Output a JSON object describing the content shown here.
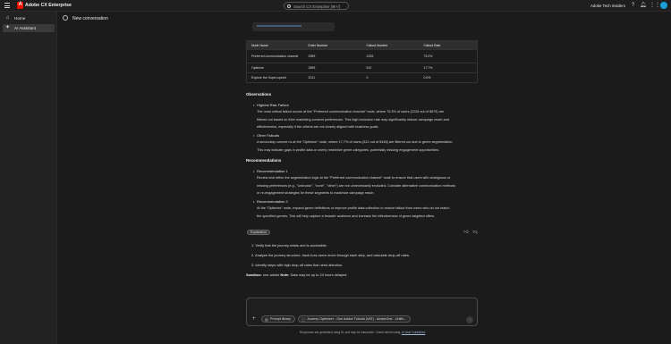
{
  "topbar": {
    "brand": "Adobe CX Enterprise",
    "search_placeholder": "Search CX Enterprise [⌘+/]",
    "org": "Adobe Tech Insiders"
  },
  "sidebar": {
    "items": [
      {
        "label": "Home",
        "icon": "home-icon"
      },
      {
        "label": "AI Assistant",
        "icon": "ai-assistant-icon"
      }
    ]
  },
  "conversation": {
    "title": "New conversation"
  },
  "table": {
    "headers": [
      "Node Name",
      "Enter Number",
      "Fallout Number",
      "Fallout Rate"
    ],
    "rows": [
      [
        "Preferred communication channel",
        "2959",
        "2226",
        "75.2%"
      ],
      [
        "Optimize",
        "2895",
        "512",
        "17.7%"
      ],
      [
        "Explore the Super-speed",
        "2011",
        "0",
        "0.0%"
      ]
    ]
  },
  "observations": {
    "heading": "Observations",
    "items": [
      {
        "title": "Highest Risk Fallout",
        "text": [
          "The most critical fallout occurs at the \"Preferred communication channel\" node, where 75.3% of users (2226 out of 8679) are",
          "filtered out based on their marketing consent preferences. This high exclusion rate may significantly reduce campaign reach and",
          "effectiveness, especially if the criteria are not closely aligned with business goals."
        ]
      },
      {
        "title": "Other Fallouts",
        "text": [
          "A secondary concern is at the \"Optimize\" node, where 17.7% of users (512 out of 5448) are filtered out due to genre segmentation.",
          "This may indicate gaps in profile data or overly restrictive genre categories, potentially missing engagement opportunities."
        ]
      }
    ]
  },
  "recommendations": {
    "heading": "Recommendations",
    "items": [
      {
        "title": "Recommendation 1",
        "text": [
          "Review and refine the segmentation logic at the \"Preferred communication channel\" node to ensure that users with ambiguous or",
          "missing preferences (e.g., \"unknown\", \"none\", \"other\") are not unnecessarily excluded. Consider alternative communication methods",
          "or re-engagement strategies for these segments to maximize campaign reach."
        ]
      },
      {
        "title": "Recommendation 2",
        "text": [
          "At the \"Optimize\" node, expand genre definitions or improve profile data collection to reduce fallout from users who do not match",
          "the specified genres. This will help capture a broader audience and increase the effectiveness of genre-targeted offers."
        ]
      }
    ]
  },
  "explanation": {
    "badge": "Explanation",
    "steps": [
      "1. Verify that the journey exists and is accessible.",
      "2. Analyze the journey structure, track how users move through each step, and calculate drop-off rates.",
      "3. Identify steps with high drop-off rates that need attention."
    ],
    "sandbox_label": "Sandbox:",
    "sandbox_value": "one-adobe",
    "note_label": "Note:",
    "note_value": "Data may be up to 24 hours delayed."
  },
  "composer": {
    "chip_library": "Prompt library",
    "chip_context": "Journey Optimizer - One Adobe Tutorial (VAT) - AdobeOne - Unifie..."
  },
  "disclaimer": {
    "text": "Responses are generated using AI, and may be inaccurate. Check before using.",
    "link": "AI User Guidelines"
  }
}
